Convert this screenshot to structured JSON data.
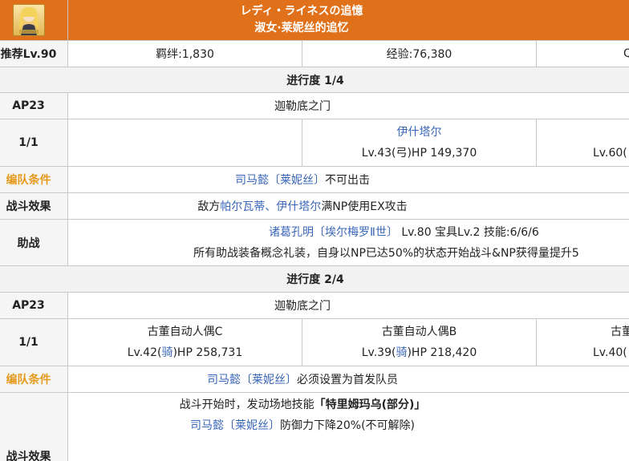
{
  "header": {
    "title_jp": "レディ・ライネスの追憶",
    "title_cn": "淑女·莱妮丝的追忆"
  },
  "recommend": {
    "level": "推荐Lv.90",
    "bond": "羁绊:1,830",
    "exp": "经验:76,380",
    "qp_partial": "Q"
  },
  "stage1": {
    "title": "进行度 1/4",
    "ap": "AP23",
    "place": "迦勒底之门",
    "wave": "1/1",
    "enemy_name": "伊什塔尔",
    "enemy_stats": "Lv.43(弓)HP 149,370",
    "enemy_partial": "Lv.60(",
    "formation_label": "编队条件",
    "formation_servant": "司马懿〔莱妮丝〕",
    "formation_rule": "不可出击",
    "battle_label": "战斗效果",
    "battle_prefix": "敌方",
    "battle_targets": "帕尔瓦蒂、伊什塔尔",
    "battle_suffix": "满NP使用EX攻击",
    "support_label": "助战",
    "support_servant": "诸葛孔明〔埃尔梅罗Ⅱ世〕",
    "support_stats": "Lv.80 宝具Lv.2 技能:6/6/6",
    "support_note": "所有助战装备概念礼装，自身以NP已达50%的状态开始战斗&NP获得量提升5"
  },
  "stage2": {
    "title": "进行度 2/4",
    "ap": "AP23",
    "place": "迦勒底之门",
    "wave": "1/1",
    "enemy1_name": "古董自动人偶C",
    "enemy1_lv": "Lv.42(",
    "enemy1_class": "骑",
    "enemy1_hp": ")HP 258,731",
    "enemy2_name": "古董自动人偶B",
    "enemy2_lv": "Lv.39(",
    "enemy2_class": "骑",
    "enemy2_hp": ")HP 218,420",
    "enemy3_name_partial": "古董",
    "enemy3_partial": "Lv.40(",
    "formation_label": "编队条件",
    "formation_servant": "司马懿〔莱妮丝〕",
    "formation_rule": "必须设置为首发队员",
    "battle_label": "战斗效果",
    "battle_line1": "战斗开始时，发动场地技能",
    "battle_skill": "「特里姆玛乌(部分)」",
    "battle_servant": "司马懿〔莱妮丝〕",
    "battle_effect": "防御力下降20%(不可解除)"
  }
}
